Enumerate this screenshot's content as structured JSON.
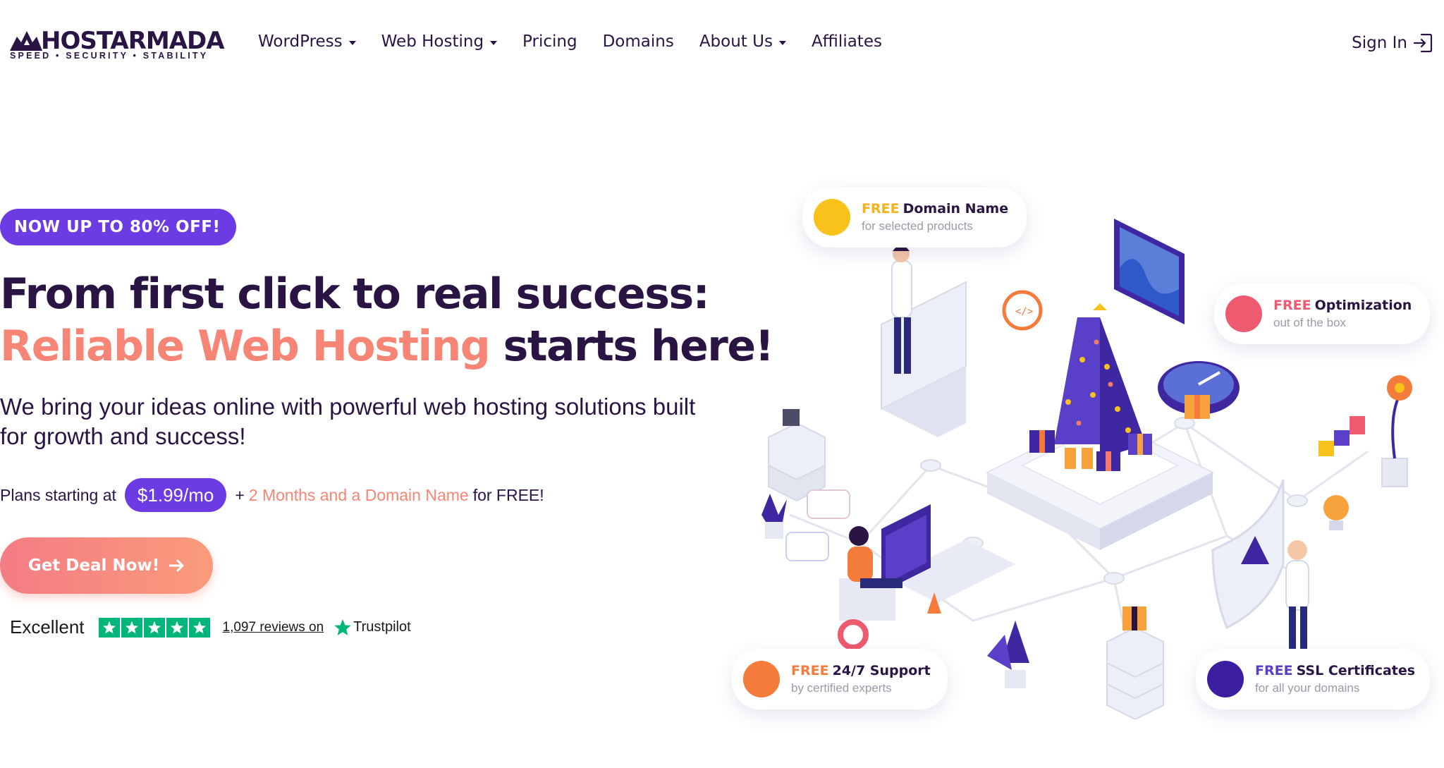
{
  "brand": {
    "name": "HOSTARMADA",
    "tagline": "SPEED • SECURITY • STABILITY"
  },
  "nav": {
    "items": [
      {
        "label": "WordPress",
        "dropdown": true
      },
      {
        "label": "Web Hosting",
        "dropdown": true
      },
      {
        "label": "Pricing",
        "dropdown": false
      },
      {
        "label": "Domains",
        "dropdown": false
      },
      {
        "label": "About Us",
        "dropdown": true
      },
      {
        "label": "Affiliates",
        "dropdown": false
      }
    ],
    "sign_in": "Sign In"
  },
  "hero": {
    "badge": "NOW UP TO 80% OFF!",
    "headline_line1": "From first click to real success:",
    "headline_accent": "Reliable Web Hosting",
    "headline_line2_rest": " starts here!",
    "subhead": "We bring your ideas online with powerful web hosting solutions built for growth and success!",
    "plans_prefix": "Plans starting at",
    "price": "$1.99/mo",
    "plus": "+",
    "bonus": "2 Months and a Domain Name",
    "plans_suffix": "for FREE!",
    "cta": "Get Deal Now!"
  },
  "trustpilot": {
    "rating_label": "Excellent",
    "stars": 5,
    "reviews_text": "1,097 reviews on",
    "brand": "Trustpilot"
  },
  "features": [
    {
      "free": "FREE",
      "title": "Domain Name",
      "sub": "for selected products",
      "color": "#f7c21b",
      "icon": "globe-icon"
    },
    {
      "free": "FREE",
      "title": "Optimization",
      "sub": "out of the box",
      "color": "#ee5a6f",
      "icon": "gauge-icon"
    },
    {
      "free": "FREE",
      "title": "24/7 Support",
      "sub": "by certified experts",
      "color": "#f47b3a",
      "icon": "lifebuoy-icon"
    },
    {
      "free": "FREE",
      "title": "SSL Certificates",
      "sub": "for all your domains",
      "color": "#3b1fa0",
      "icon": "lock-icon"
    }
  ],
  "colors": {
    "brand_purple": "#6c3be4",
    "text_dark": "#2a1444",
    "accent_coral": "#f78575",
    "trustpilot_green": "#00b67a"
  }
}
